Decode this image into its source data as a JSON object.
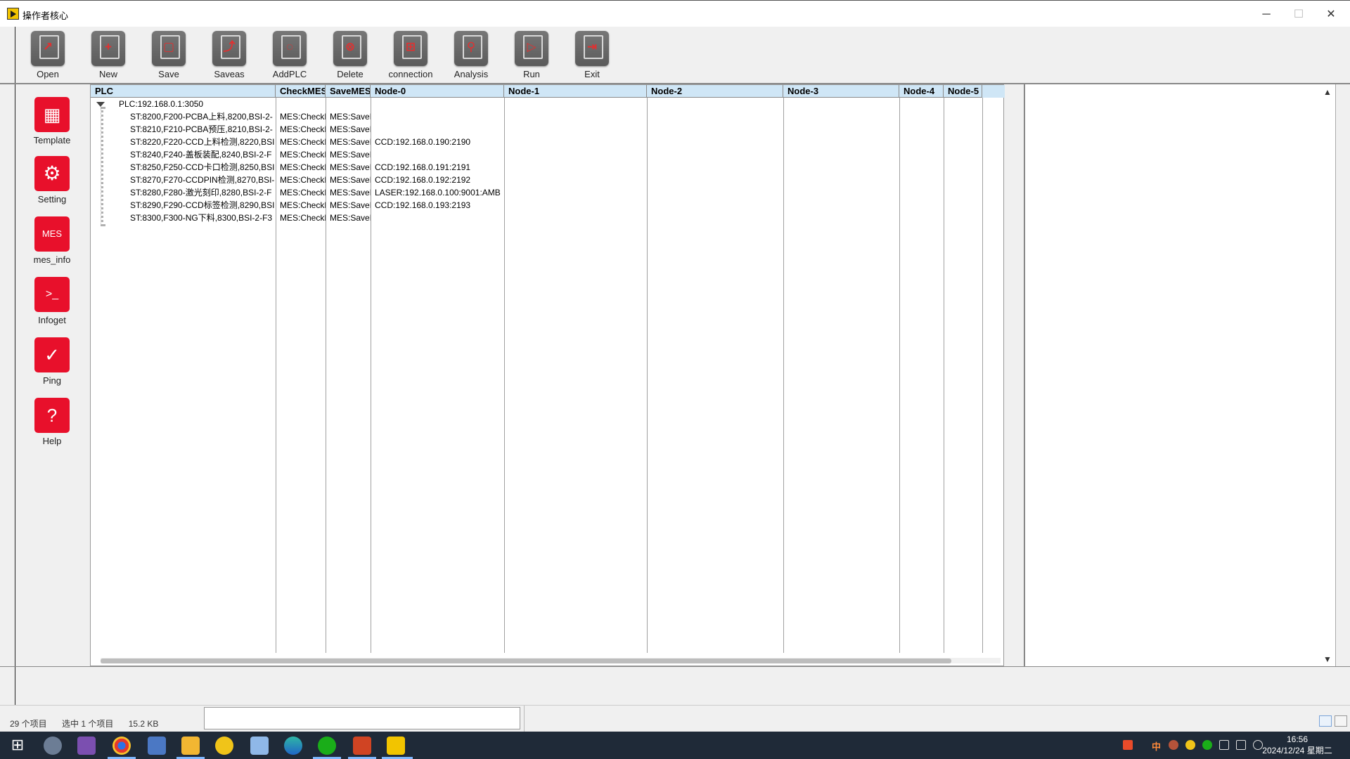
{
  "window": {
    "title": "操作者核心",
    "minimize": "─",
    "maximize": "☐",
    "close": "✕"
  },
  "toolbar": [
    {
      "label": "Open",
      "glyph": "↗"
    },
    {
      "label": "New",
      "glyph": "+"
    },
    {
      "label": "Save",
      "glyph": "▢"
    },
    {
      "label": "Saveas",
      "glyph": "⤴"
    },
    {
      "label": "AddPLC",
      "glyph": "◌"
    },
    {
      "label": "Delete",
      "glyph": "⊗"
    },
    {
      "label": "connection",
      "glyph": "⊞"
    },
    {
      "label": "Analysis",
      "glyph": "⚲"
    },
    {
      "label": "Run",
      "glyph": "▷"
    },
    {
      "label": "Exit",
      "glyph": "⇥"
    }
  ],
  "sidebar": [
    {
      "label": "Template",
      "icon": "grid-icon",
      "glyph": "▦"
    },
    {
      "label": "Setting",
      "icon": "gear-icon",
      "glyph": "⚙"
    },
    {
      "label": "mes_info",
      "icon": "mes-icon",
      "glyph": "MES"
    },
    {
      "label": "Infoget",
      "icon": "terminal-icon",
      "glyph": ">_"
    },
    {
      "label": "Ping",
      "icon": "check-icon",
      "glyph": "✓"
    },
    {
      "label": "Help",
      "icon": "help-icon",
      "glyph": "?"
    }
  ],
  "grid": {
    "columns": [
      "PLC",
      "CheckMES",
      "SaveMES",
      "Node-0",
      "Node-1",
      "Node-2",
      "Node-3",
      "Node-4",
      "Node-5"
    ],
    "root": "PLC:192.168.0.1:3050",
    "rows": [
      {
        "plc": "ST:8200,F200-PCBA上料,8200,BSI-2-",
        "check": "MES:CheckMe",
        "save": "MES:SaveMe",
        "node0": ""
      },
      {
        "plc": "ST:8210,F210-PCBA预压,8210,BSI-2-",
        "check": "MES:CheckMe",
        "save": "MES:SaveMe",
        "node0": ""
      },
      {
        "plc": "ST:8220,F220-CCD上料检测,8220,BSI",
        "check": "MES:CheckMe",
        "save": "MES:SaveMe",
        "node0": "CCD:192.168.0.190:2190"
      },
      {
        "plc": "ST:8240,F240-盖板装配,8240,BSI-2-F",
        "check": "MES:CheckMe",
        "save": "MES:SaveMe",
        "node0": ""
      },
      {
        "plc": "ST:8250,F250-CCD卡口检测,8250,BSI",
        "check": "MES:CheckMe",
        "save": "MES:SaveMe",
        "node0": "CCD:192.168.0.191:2191"
      },
      {
        "plc": "ST:8270,F270-CCDPIN检测,8270,BSI-",
        "check": "MES:CheckMe",
        "save": "MES:SaveMe",
        "node0": "CCD:192.168.0.192:2192"
      },
      {
        "plc": "ST:8280,F280-激光刻印,8280,BSI-2-F",
        "check": "MES:CheckMe",
        "save": "MES:SaveMe",
        "node0": "LASER:192.168.0.100:9001:AMB"
      },
      {
        "plc": "ST:8290,F290-CCD标签检测,8290,BSI",
        "check": "MES:CheckMe",
        "save": "MES:SaveMe",
        "node0": "CCD:192.168.0.193:2193"
      },
      {
        "plc": "ST:8300,F300-NG下料,8300,BSI-2-F3",
        "check": "MES:CheckMe",
        "save": "MES:SaveMe",
        "node0": ""
      }
    ]
  },
  "scroll": {
    "up": "▲",
    "down": "▼"
  },
  "status": {
    "items": "29 个项目",
    "selected": "选中 1 个项目",
    "size": "15.2 KB"
  },
  "taskbar": {
    "start_glyph": "⊞",
    "apps": [
      "settings-app",
      "visual-studio",
      "chrome",
      "calculator",
      "file-explorer",
      "app-yellow",
      "notepad",
      "edge",
      "wechat",
      "powerpoint",
      "labview"
    ],
    "ime": "中",
    "time": "16:56",
    "date": "2024/12/24 星期二"
  }
}
